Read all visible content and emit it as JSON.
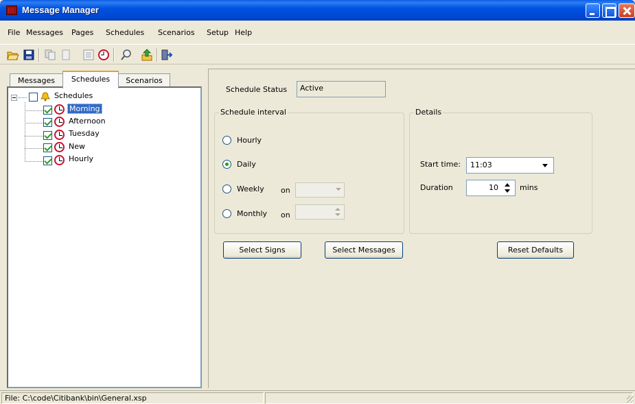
{
  "window": {
    "title": "Message Manager"
  },
  "menu": [
    "File",
    "Messages",
    "Pages",
    "Schedules",
    "Scenarios",
    "Setup",
    "Help"
  ],
  "toolbar": {
    "icons": [
      "open-folder-icon",
      "save-icon",
      "copy-icon",
      "paste-icon",
      "properties-icon",
      "schedule-clock-icon",
      "find-icon",
      "upload-icon",
      "exit-icon"
    ]
  },
  "tabs": [
    {
      "label": "Messages"
    },
    {
      "label": "Schedules",
      "active": true
    },
    {
      "label": "Scenarios"
    }
  ],
  "tree": {
    "root": {
      "label": "Schedules",
      "checked": false
    },
    "children": [
      {
        "label": "Morning",
        "checked": true,
        "selected": true
      },
      {
        "label": "Afternoon",
        "checked": true
      },
      {
        "label": "Tuesday",
        "checked": true
      },
      {
        "label": "New",
        "checked": true
      },
      {
        "label": "Hourly",
        "checked": true
      }
    ]
  },
  "schedule": {
    "status_label": "Schedule Status",
    "status_value": "Active",
    "interval": {
      "title": "Schedule interval",
      "options": [
        {
          "label": "Hourly",
          "checked": false
        },
        {
          "label": "Daily",
          "checked": true
        },
        {
          "label": "Weekly",
          "checked": false,
          "on_label": "on"
        },
        {
          "label": "Monthly",
          "checked": false,
          "on_label": "on"
        }
      ]
    },
    "details": {
      "title": "Details",
      "start_time_label": "Start time:",
      "start_time_value": "11:03",
      "duration_label": "Duration",
      "duration_value": "10",
      "duration_unit": "mins"
    },
    "buttons": {
      "select_signs": "Select Signs",
      "select_messages": "Select Messages",
      "reset_defaults": "Reset Defaults"
    }
  },
  "statusbar": {
    "file": "File: C:\\code\\Citibank\\bin\\General.xsp",
    "second": ""
  },
  "colors": {
    "titlebar": "#0053e1",
    "selection": "#316ac5",
    "window_bg": "#ece9d8",
    "tab_accent": "#e69e33",
    "check": "#21a121",
    "clock": "#c8102e"
  }
}
